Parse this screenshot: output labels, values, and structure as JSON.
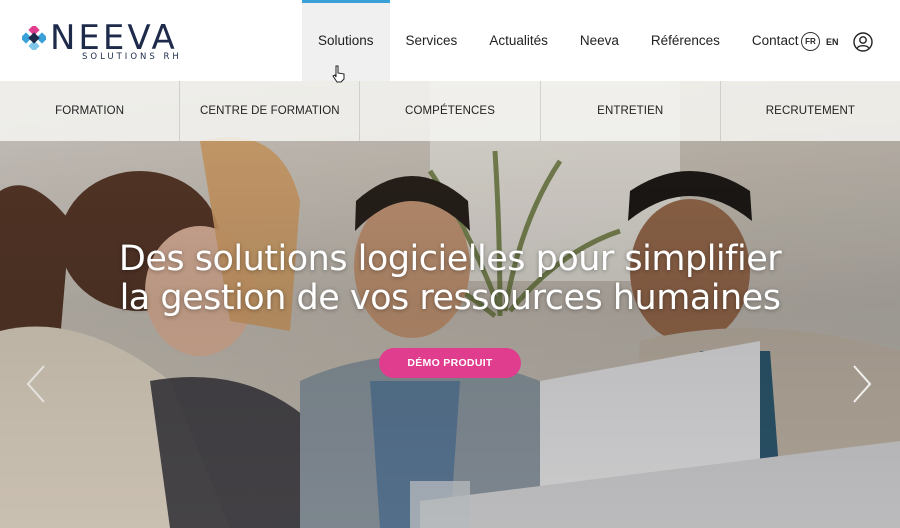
{
  "brand": {
    "name": "NEEVA",
    "tagline": "SOLUTIONS RH",
    "colors": {
      "navy": "#1d2a4a",
      "pink": "#e03d8f",
      "blue": "#3aa0d8"
    }
  },
  "nav": {
    "items": [
      {
        "label": "Solutions",
        "active": true
      },
      {
        "label": "Services"
      },
      {
        "label": "Actualités"
      },
      {
        "label": "Neeva"
      },
      {
        "label": "Références"
      },
      {
        "label": "Contact"
      }
    ]
  },
  "lang": {
    "fr": "FR",
    "en": "EN"
  },
  "subnav": {
    "items": [
      {
        "label": "FORMATION"
      },
      {
        "label": "CENTRE DE FORMATION"
      },
      {
        "label": "COMPÉTENCES"
      },
      {
        "label": "ENTRETIEN"
      },
      {
        "label": "RECRUTEMENT"
      }
    ]
  },
  "hero": {
    "headline_line1": "Des solutions logicielles pour simplifier",
    "headline_line2": "la gestion de vos ressources humaines",
    "cta_label": "DÉMO PRODUIT"
  },
  "icons": [
    "neeva-logo-icon",
    "cursor-icon",
    "user-icon",
    "chevron-left-icon",
    "chevron-right-icon"
  ]
}
